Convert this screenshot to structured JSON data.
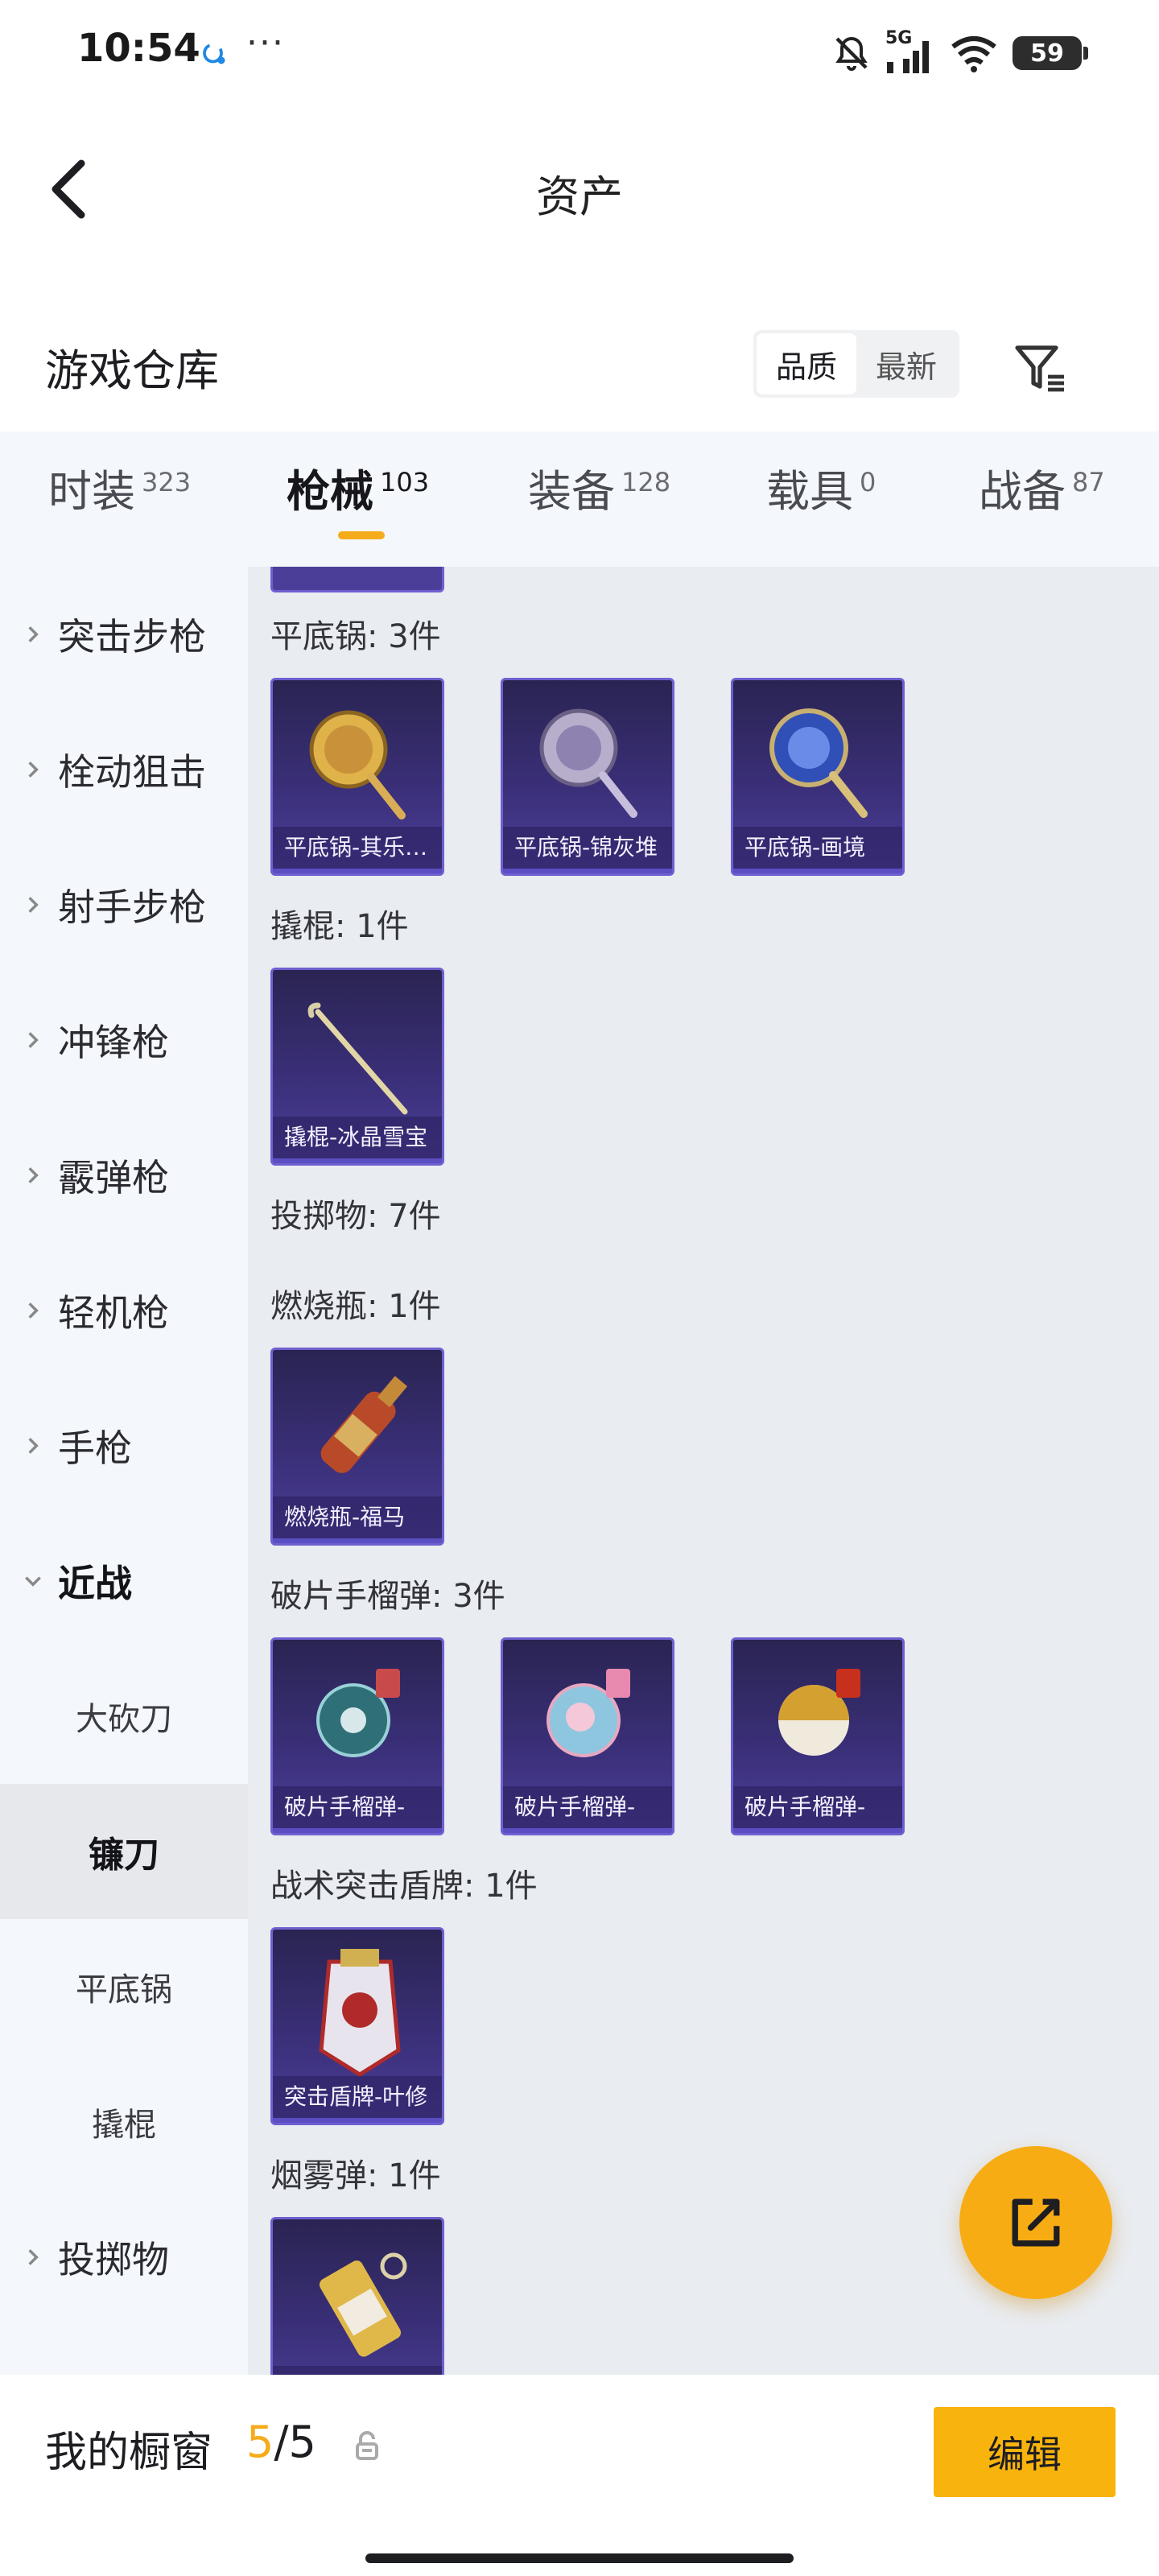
{
  "status_bar": {
    "time": "10:54",
    "dots": "···",
    "network": "5G",
    "battery": "59",
    "icons": [
      "sync-icon",
      "bell-muted-icon",
      "signal-icon",
      "wifi-icon",
      "battery-icon"
    ]
  },
  "header": {
    "title": "资产",
    "back_icon": "chevron-left-icon"
  },
  "warehouse": {
    "title": "游戏仓库",
    "sort_options": [
      "品质",
      "最新"
    ],
    "selected_sort": "品质",
    "filter_icon": "filter-icon"
  },
  "tabs": [
    {
      "label": "时装",
      "count": "323",
      "active": false
    },
    {
      "label": "枪械",
      "count": "103",
      "active": true
    },
    {
      "label": "装备",
      "count": "128",
      "active": false
    },
    {
      "label": "载具",
      "count": "0",
      "active": false
    },
    {
      "label": "战备",
      "count": "87",
      "active": false
    }
  ],
  "sidebar": {
    "items": [
      {
        "label": "突击步枪",
        "type": "group",
        "expanded": false
      },
      {
        "label": "栓动狙击",
        "type": "group",
        "expanded": false
      },
      {
        "label": "射手步枪",
        "type": "group",
        "expanded": false
      },
      {
        "label": "冲锋枪",
        "type": "group",
        "expanded": false
      },
      {
        "label": "霰弹枪",
        "type": "group",
        "expanded": false
      },
      {
        "label": "轻机枪",
        "type": "group",
        "expanded": false
      },
      {
        "label": "手枪",
        "type": "group",
        "expanded": false
      },
      {
        "label": "近战",
        "type": "group",
        "expanded": true
      },
      {
        "label": "大砍刀",
        "type": "sub",
        "active": false
      },
      {
        "label": "镰刀",
        "type": "sub",
        "active": true
      },
      {
        "label": "平底锅",
        "type": "sub",
        "active": false
      },
      {
        "label": "撬棍",
        "type": "sub",
        "active": false
      },
      {
        "label": "投掷物",
        "type": "group",
        "expanded": false
      }
    ]
  },
  "content": {
    "sections": [
      {
        "label": "平底锅: 3件",
        "items": [
          "平底锅-其乐融融",
          "平底锅-锦灰堆",
          "平底锅-画境"
        ]
      },
      {
        "label": "撬棍: 1件",
        "items": [
          "撬棍-冰晶雪宝"
        ]
      },
      {
        "label": "投掷物: 7件",
        "items": []
      },
      {
        "label": "燃烧瓶: 1件",
        "items": [
          "燃烧瓶-福马"
        ]
      },
      {
        "label": "破片手榴弹: 3件",
        "items": [
          "破片手榴弹-",
          "破片手榴弹-",
          "破片手榴弹-"
        ]
      },
      {
        "label": "战术突击盾牌: 1件",
        "items": [
          "突击盾牌-叶修"
        ]
      },
      {
        "label": "烟雾弹: 1件",
        "items": [
          ""
        ]
      }
    ]
  },
  "fab": {
    "icon": "share-external-icon"
  },
  "bottom_bar": {
    "title": "我的橱窗",
    "count_current": "5",
    "count_total": "/5",
    "lock_icon": "lock-icon",
    "edit_label": "编辑"
  },
  "colors": {
    "accent": "#f5ac1b",
    "card_bg": "#3a2f78",
    "card_border": "#6e5fd0",
    "content_bg": "#e9ecf0",
    "sidebar_bg": "#f4f7fb"
  }
}
